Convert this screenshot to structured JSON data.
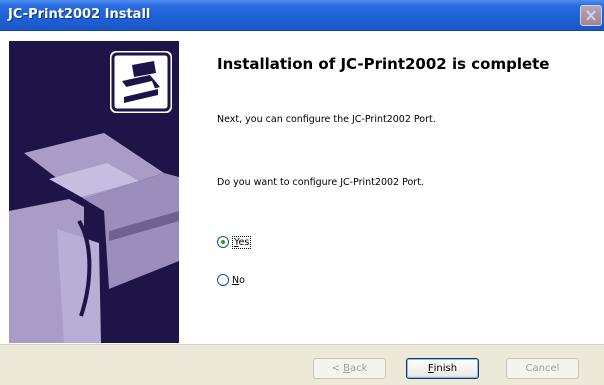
{
  "window": {
    "title": "JC-Print2002 Install"
  },
  "content": {
    "heading": "Installation of JC-Print2002 is complete",
    "line1": "Next, you can configure the JC-Print2002 Port.",
    "line2": "Do you want to configure JC-Print2002 Port."
  },
  "options": {
    "yes": {
      "mnemonic": "Y",
      "rest": "es",
      "selected": true
    },
    "no": {
      "mnemonic": "N",
      "rest": "o",
      "selected": false
    }
  },
  "buttons": {
    "back": {
      "prefix": "< ",
      "mnemonic": "B",
      "rest": "ack"
    },
    "finish": {
      "mnemonic": "F",
      "rest": "inish"
    },
    "cancel": {
      "label": "Cancel"
    }
  },
  "colors": {
    "titlebar": "#2a6ee0",
    "sidebar": "#1e1447",
    "printer_art": "#a99cc6",
    "footer": "#ece9d8",
    "radio_dot": "#21a121"
  }
}
